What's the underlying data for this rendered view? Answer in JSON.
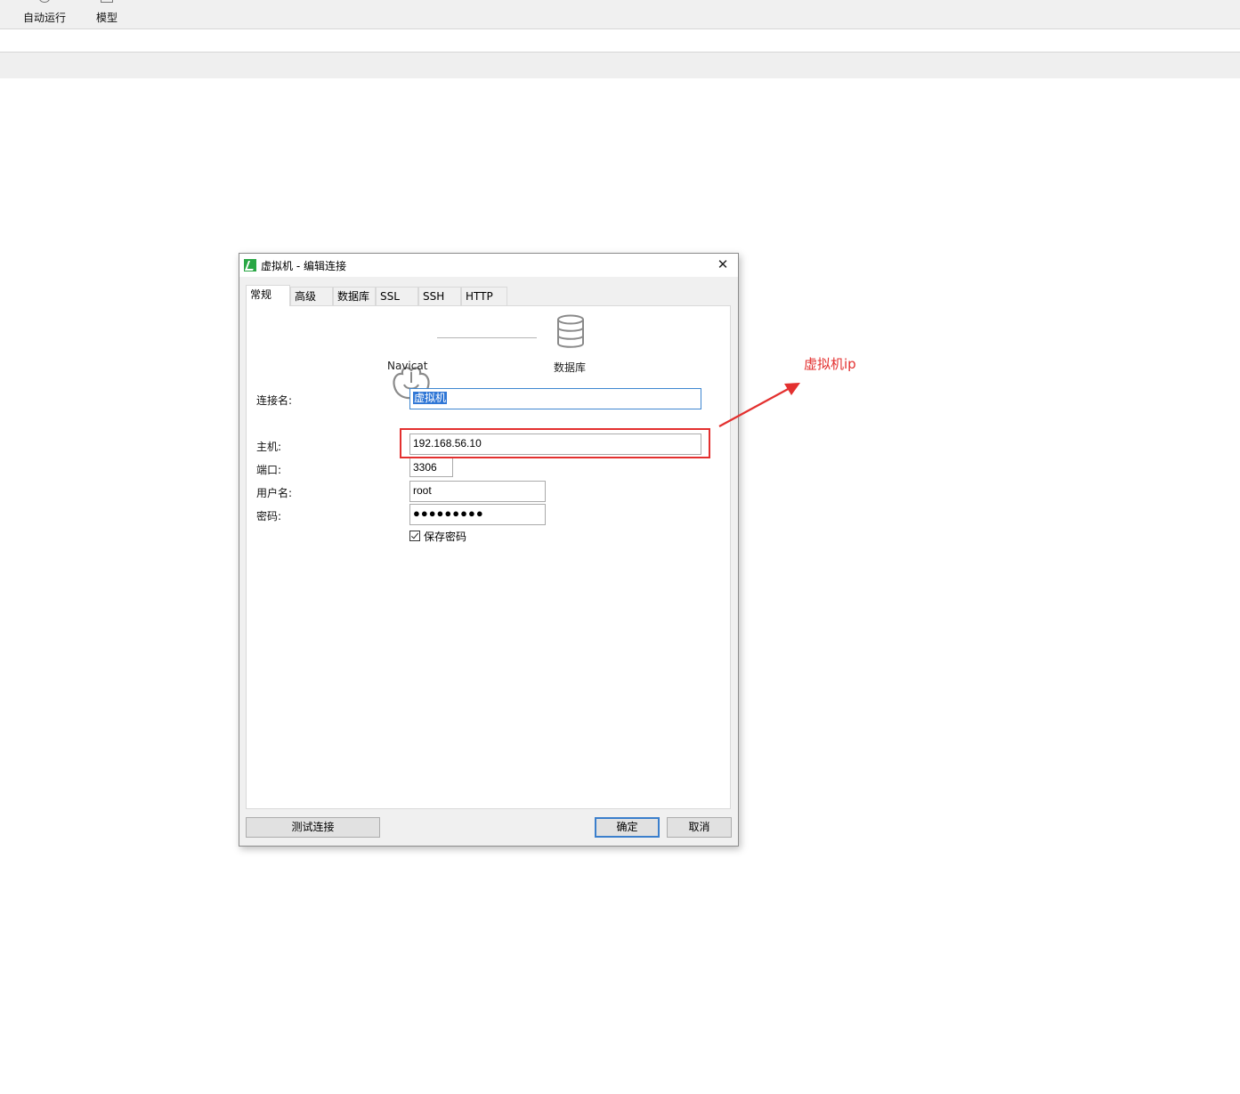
{
  "app_toolbar": {
    "items": [
      {
        "label": "自动运行",
        "icon": "clock-icon"
      },
      {
        "label": "模型",
        "icon": "model-icon"
      }
    ]
  },
  "dialog": {
    "title": "虚拟机 - 编辑连接",
    "close_icon": "close-icon",
    "tabs": [
      {
        "label": "常规",
        "active": true
      },
      {
        "label": "高级"
      },
      {
        "label": "数据库"
      },
      {
        "label": "SSL"
      },
      {
        "label": "SSH"
      },
      {
        "label": "HTTP"
      }
    ],
    "diagram": {
      "left_label": "Navicat",
      "right_label": "数据库"
    },
    "form": {
      "connection_name": {
        "label": "连接名:",
        "value": "虚拟机"
      },
      "host": {
        "label": "主机:",
        "value": "192.168.56.10"
      },
      "port": {
        "label": "端口:",
        "value": "3306"
      },
      "username": {
        "label": "用户名:",
        "value": "root"
      },
      "password": {
        "label": "密码:",
        "value": "●●●●●●●●●"
      },
      "save_password": {
        "label": "保存密码",
        "checked": true
      }
    },
    "buttons": {
      "test": "测试连接",
      "ok": "确定",
      "cancel": "取消"
    }
  },
  "annotation": {
    "text": "虚拟机ip",
    "color": "#e3302f"
  }
}
